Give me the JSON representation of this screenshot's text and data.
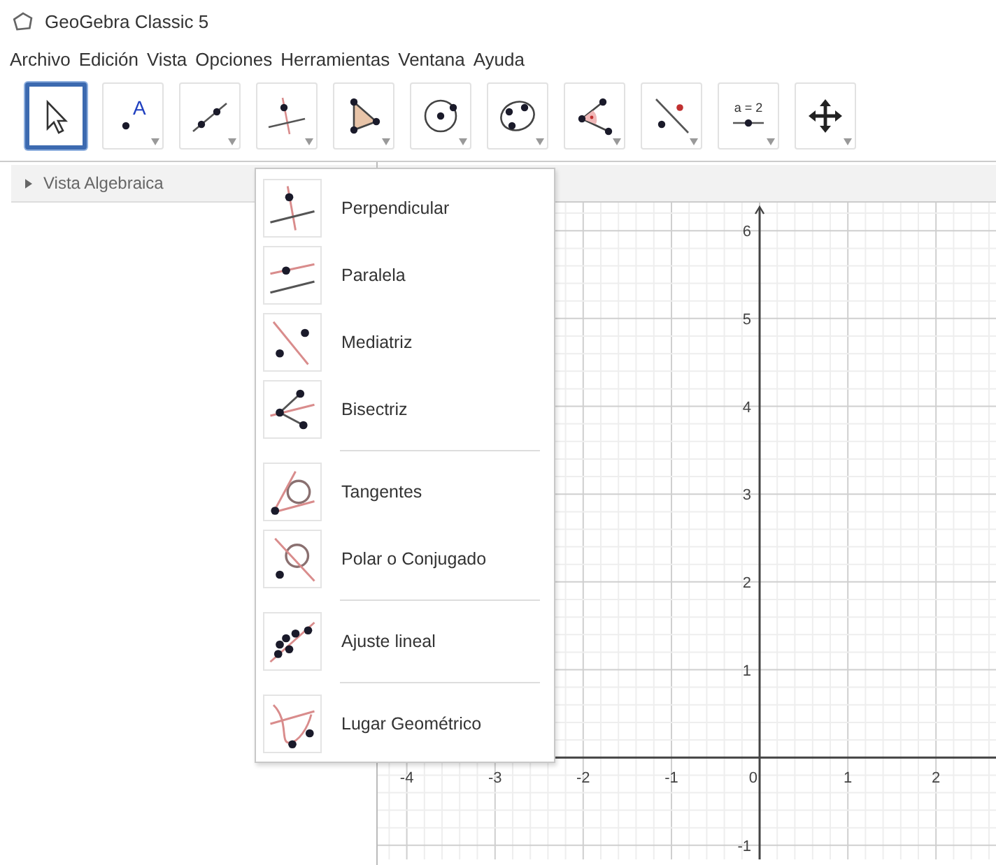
{
  "window": {
    "title": "GeoGebra Classic 5"
  },
  "menu_bar": [
    "Archivo",
    "Edición",
    "Vista",
    "Opciones",
    "Herramientas",
    "Ventana",
    "Ayuda"
  ],
  "toolbar": [
    {
      "kind": "move",
      "selected": true
    },
    {
      "kind": "point",
      "selected": false,
      "icon_text": "A"
    },
    {
      "kind": "line",
      "selected": false
    },
    {
      "kind": "perpendicular",
      "selected": false
    },
    {
      "kind": "polygon",
      "selected": false
    },
    {
      "kind": "circle",
      "selected": false
    },
    {
      "kind": "conic",
      "selected": false
    },
    {
      "kind": "angle",
      "selected": false
    },
    {
      "kind": "reflect",
      "selected": false
    },
    {
      "kind": "slider",
      "selected": false,
      "icon_text": "a = 2"
    },
    {
      "kind": "move_view",
      "selected": false
    }
  ],
  "algebra_view": {
    "title": "Vista Algebraica"
  },
  "tool_menu": {
    "groups": [
      [
        {
          "kind": "perpendicular",
          "label": "Perpendicular"
        },
        {
          "kind": "parallel",
          "label": "Paralela"
        },
        {
          "kind": "bisector",
          "label": "Mediatriz"
        },
        {
          "kind": "angle_bisector",
          "label": "Bisectriz"
        }
      ],
      [
        {
          "kind": "tangents",
          "label": "Tangentes"
        },
        {
          "kind": "polar",
          "label": "Polar o Conjugado"
        }
      ],
      [
        {
          "kind": "fit_line",
          "label": "Ajuste lineal"
        }
      ],
      [
        {
          "kind": "locus",
          "label": "Lugar Geométrico"
        }
      ]
    ]
  },
  "graphics_view": {
    "chart_data": {
      "type": "line",
      "xlim": [
        -4.33,
        2.68
      ],
      "ylim": [
        -1.16,
        6.32
      ],
      "xticks": [
        -4,
        -3,
        -2,
        -1,
        0,
        1,
        2
      ],
      "yticks": [
        -1,
        1,
        2,
        3,
        4,
        5,
        6
      ],
      "grid": true
    }
  }
}
